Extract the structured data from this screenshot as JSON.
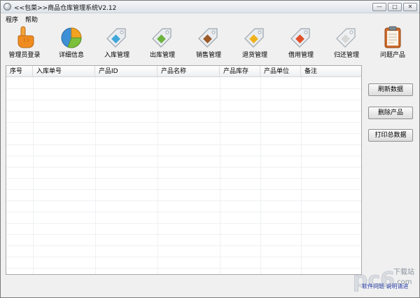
{
  "window": {
    "title": "<<包菜>>商品仓库管理系统V2.12",
    "controls": {
      "minimize": "—",
      "maximize": "□",
      "close": "✕"
    }
  },
  "menu": {
    "items": [
      "程序",
      "帮助"
    ]
  },
  "toolbar": {
    "items": [
      {
        "label": "管理员登录",
        "icon": "hand-pointer-icon",
        "color": "#f0941e"
      },
      {
        "label": "详细信息",
        "icon": "pie-chart-icon",
        "color": "#3d8fd6"
      },
      {
        "label": "入库管理",
        "icon": "tag-icon",
        "color": "#3fa7d9"
      },
      {
        "label": "出库管理",
        "icon": "tag-icon",
        "color": "#6cb33f"
      },
      {
        "label": "销售管理",
        "icon": "tag-icon",
        "color": "#9b5a2a"
      },
      {
        "label": "退货管理",
        "icon": "tag-icon",
        "color": "#f0b21c"
      },
      {
        "label": "借用管理",
        "icon": "tag-icon",
        "color": "#e0502a"
      },
      {
        "label": "归还管理",
        "icon": "tag-icon",
        "color": "#d7d7d7"
      },
      {
        "label": "问题产品",
        "icon": "clipboard-icon",
        "color": "#d06b2a"
      }
    ]
  },
  "table": {
    "columns": [
      "序号",
      "入库单号",
      "产品ID",
      "产品名称",
      "产品库存",
      "产品单位",
      "备注"
    ],
    "rows": []
  },
  "actions": {
    "refresh": "刷新数据",
    "delete": "删除产品",
    "print": "打印总数据"
  },
  "footer": {
    "link": "软件问题 说明请进"
  },
  "watermark": {
    "text": "pc6",
    "sub": "下载站",
    "domain": ".com"
  }
}
